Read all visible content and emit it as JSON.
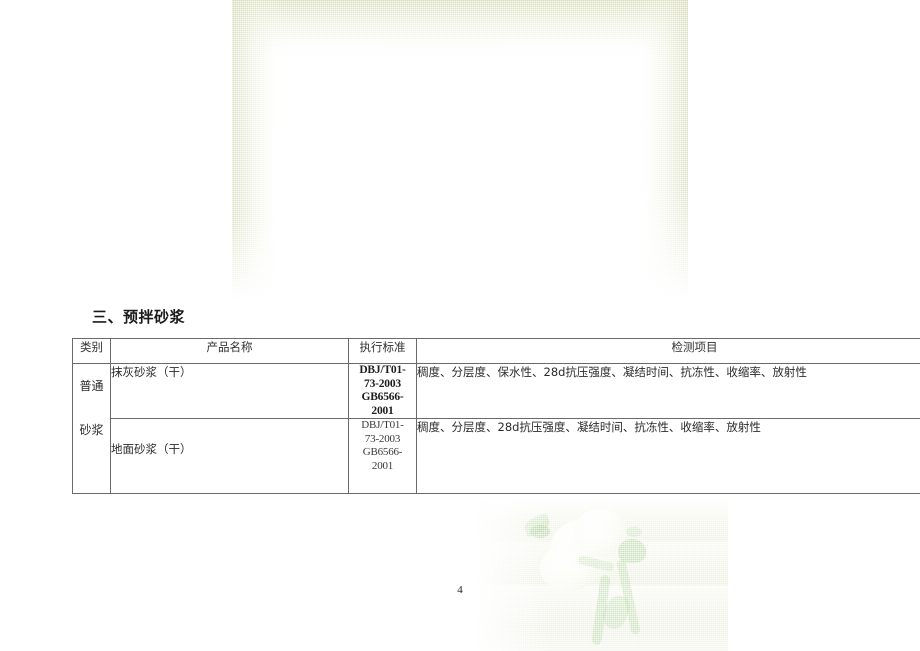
{
  "document": {
    "section_heading": "三、预拌砂浆",
    "page_number": "4"
  },
  "table": {
    "headers": {
      "category": "类别",
      "product_name": "产品名称",
      "standard": "执行标准",
      "test_items": "检测项目"
    },
    "category_merged": {
      "line1": "普通",
      "line2": "砂浆"
    },
    "rows": [
      {
        "product_name": "抹灰砂浆（干）",
        "standard_lines": [
          "DBJ/T01-",
          "73-2003",
          "GB6566-",
          "2001"
        ],
        "test_items": "稠度、分层度、保水性、28d抗压强度、凝结时间、抗冻性、收缩率、放射性"
      },
      {
        "product_name": "地面砂浆（干）",
        "standard_lines": [
          "DBJ/T01-",
          "73-2003",
          "GB6566-",
          "2001"
        ],
        "test_items": "稠度、分层度、28d抗压强度、凝结时间、抗冻性、收缩率、放射性"
      }
    ]
  },
  "decoration": {
    "top_watermark": "faded-green-border-watermark",
    "bottom_watermark": "faded-white-flowers-watermark",
    "accent_color": "#cfd4aa",
    "leaf_color": "#96c882"
  }
}
